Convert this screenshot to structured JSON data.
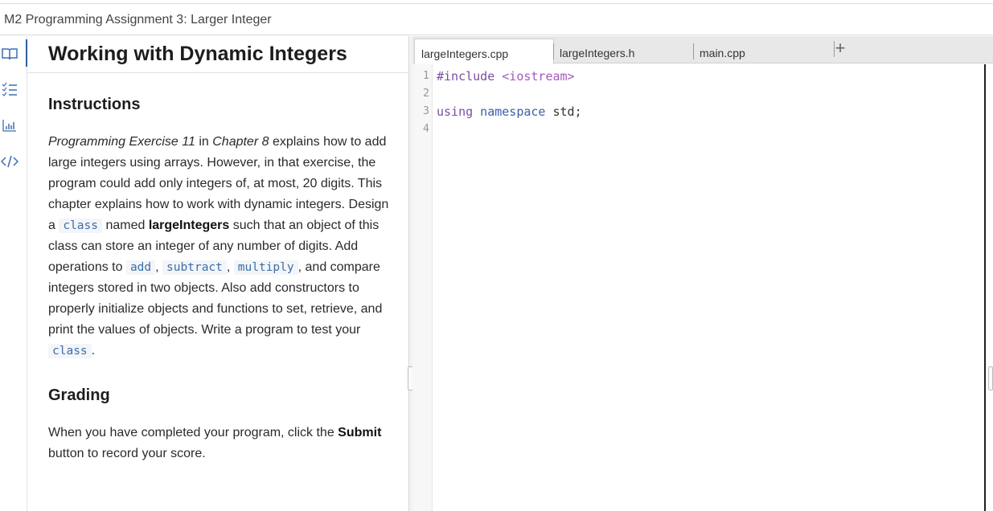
{
  "window": {
    "title": "M2 Programming Assignment 3: Larger Integer"
  },
  "rail": {
    "icons": [
      "book-icon",
      "checklist-icon",
      "chart-icon",
      "code-icon"
    ]
  },
  "instructions": {
    "title": "Working with Dynamic Integers",
    "section1": "Instructions",
    "p1": {
      "t1": "Programming Exercise 11",
      "t2": " in ",
      "t3": "Chapter 8",
      "t4": " explains how to add large integers using arrays. However, in that exercise, the program could add only integers of, at most, 20 digits. This chapter explains how to work with dynamic integers. Design a ",
      "c1": "class",
      "t5": " named ",
      "b1": "largeIntegers",
      "t6": " such that an object of this class can store an integer of any number of digits. Add operations to ",
      "c2": "add",
      "t7": ", ",
      "c3": "subtract",
      "t8": ", ",
      "c4": "multiply",
      "t9": ", and compare integers stored in two objects. Also add constructors to properly initialize objects and functions to set, retrieve, and print the values of objects. Write a program to test your ",
      "c5": "class",
      "t10": "."
    },
    "section2": "Grading",
    "p2": {
      "t1": "When you have completed your program, click the ",
      "b1": "Submit",
      "t2": " button to record your score."
    }
  },
  "editor": {
    "tabs": [
      {
        "label": "largeIntegers.cpp",
        "active": true
      },
      {
        "label": "largeIntegers.h",
        "active": false
      },
      {
        "label": "main.cpp",
        "active": false
      }
    ],
    "add_tab": "+",
    "lines": [
      {
        "n": "1",
        "a": "#include",
        "b": " <iostream>",
        "c": ""
      },
      {
        "n": "2",
        "a": "",
        "b": "",
        "c": ""
      },
      {
        "n": "3",
        "a": "using",
        "b": " namespace",
        "c": " std;"
      },
      {
        "n": "4",
        "a": "",
        "b": "",
        "c": ""
      }
    ]
  }
}
